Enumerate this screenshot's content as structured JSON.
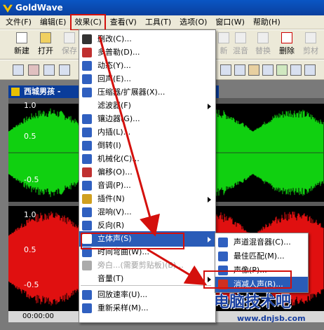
{
  "window": {
    "title": "GoldWave"
  },
  "menubar": [
    "文件(F)",
    "编辑(E)",
    "效果(C)",
    "查看(V)",
    "工具(T)",
    "选项(O)",
    "窗口(W)",
    "帮助(H)"
  ],
  "toolbar": {
    "new": "新建",
    "open": "打开",
    "save": "保存",
    "new2": "新",
    "mix": "混音",
    "replace": "替换",
    "delete": "删除",
    "cut": "剪材"
  },
  "doc": {
    "title": "西城男孩 -"
  },
  "wave_labels": {
    "top1": "1.0",
    "top2": "0.5",
    "top3": "-0.5",
    "bot1": "1.0",
    "bot2": "0.5",
    "bot3": "-0.5",
    "bottom_time": "00:00:00"
  },
  "effects_menu": [
    {
      "label": "删改(C)...",
      "icon_color": "#333"
    },
    {
      "label": "多普勒(D)...",
      "icon_color": "#c03030"
    },
    {
      "label": "动态(Y)...",
      "icon_color": "#3060c0"
    },
    {
      "label": "回声(E)...",
      "icon_color": "#3060c0"
    },
    {
      "label": "压缩器/扩展器(X)...",
      "icon_color": "#3060c0"
    },
    {
      "label": "滤波器(F)",
      "icon_color": "#ffffff"
    },
    {
      "label": "镶边器(G)...",
      "icon_color": "#3060c0"
    },
    {
      "label": "内插(L)...",
      "icon_color": "#3060c0"
    },
    {
      "label": "倒转(I)",
      "icon_color": "#3060c0"
    },
    {
      "label": "机械化(C)...",
      "icon_color": "#3060c0"
    },
    {
      "label": "偏移(O)...",
      "icon_color": "#c03030"
    },
    {
      "label": "音调(P)...",
      "icon_color": "#3060c0"
    },
    {
      "label": "插件(N)",
      "icon_color": "#d0a020"
    },
    {
      "label": "混响(V)...",
      "icon_color": "#3060c0"
    },
    {
      "label": "反向(R)",
      "icon_color": "#3060c0"
    },
    {
      "label": "立体声(S)",
      "icon_color": "#ffffff"
    },
    {
      "label": "时间弯曲(W)...",
      "icon_color": "#3060c0"
    },
    {
      "label": "旁白...(需要剪贴板)(B)...",
      "icon_color": "#aaaaaa"
    },
    {
      "label": "音量(T)",
      "icon_color": "#ffffff"
    },
    {
      "label": "回放速率(U)...",
      "icon_color": "#3060c0"
    },
    {
      "label": "重新采样(M)...",
      "icon_color": "#3060c0"
    }
  ],
  "stereo_submenu": [
    {
      "label": "声道混音器(C)..."
    },
    {
      "label": "最佳匹配(M)..."
    },
    {
      "label": "声像(P)..."
    },
    {
      "label": "消减人声(R)..."
    }
  ],
  "watermark": {
    "text": "电脑技术吧",
    "url": "www.dnjsb.com"
  },
  "colors": {
    "wave_green": "#10d010",
    "wave_red": "#e01010",
    "highlight": "#2a5cb8",
    "annotation": "#d4100c"
  }
}
